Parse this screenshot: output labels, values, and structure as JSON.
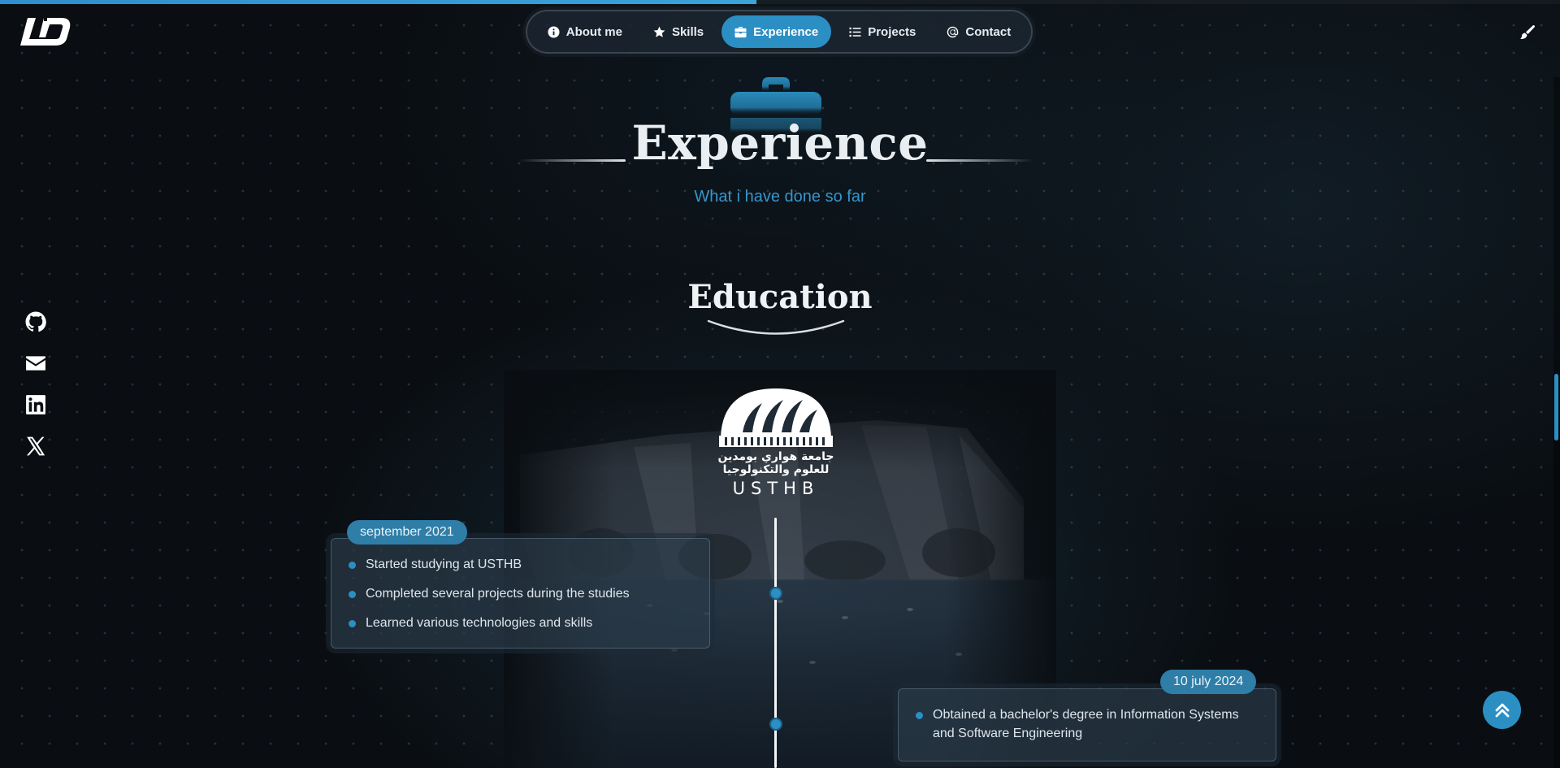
{
  "progress": {
    "percent": 48.5,
    "color": "#2f8fd0"
  },
  "logo": {
    "text": "LD"
  },
  "nav": {
    "items": [
      {
        "label": "About me",
        "icon": "info-circle-icon",
        "active": false
      },
      {
        "label": "Skills",
        "icon": "star-icon",
        "active": false
      },
      {
        "label": "Experience",
        "icon": "briefcase-icon",
        "active": true
      },
      {
        "label": "Projects",
        "icon": "list-icon",
        "active": false
      },
      {
        "label": "Contact",
        "icon": "at-sign-icon",
        "active": false
      }
    ]
  },
  "theme_toggle": {
    "icon": "paintbrush-icon"
  },
  "social": [
    {
      "name": "github",
      "icon": "github-icon"
    },
    {
      "name": "email",
      "icon": "envelope-icon"
    },
    {
      "name": "linkedin",
      "icon": "linkedin-icon"
    },
    {
      "name": "x",
      "icon": "x-twitter-icon"
    }
  ],
  "section": {
    "icon": "briefcase-icon",
    "title": "Experience",
    "subtitle": "What i have done so far"
  },
  "education": {
    "title": "Education",
    "institution_logo": {
      "arabic_line1": "جامعة هواري بومدين",
      "arabic_line2": "للعلوم والتكنولوجيا",
      "latin": "USTHB"
    },
    "timeline": [
      {
        "date": "september 2021",
        "items": [
          "Started studying at USTHB",
          "Completed several projects during the studies",
          "Learned various technologies and skills"
        ]
      },
      {
        "date": "10 july 2024",
        "items": [
          "Obtained a bachelor's degree in Information Systems and Software Engineering"
        ]
      }
    ]
  },
  "scroll_top": {
    "icon": "double-chevron-up-icon"
  },
  "colors": {
    "accent": "#2b8fc4",
    "background": "#0a0e12",
    "card": "#2a3a48",
    "subtitle": "#3596cc"
  }
}
